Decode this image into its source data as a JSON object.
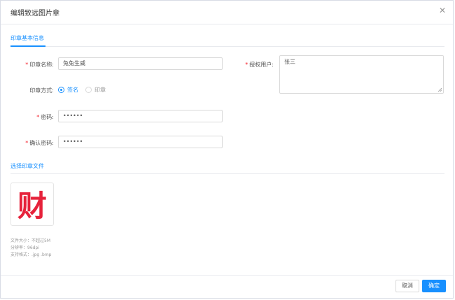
{
  "dialog": {
    "title": "编辑致远图片章",
    "close_icon": "close-icon"
  },
  "sections": {
    "basic_info_tab": "印章基本信息",
    "select_file_tab": "选择印章文件"
  },
  "form": {
    "seal_name": {
      "label": "印章名称:",
      "value": "兔兔生威",
      "required": true
    },
    "authorized_user": {
      "label": "授权用户:",
      "value": "张三",
      "required": true
    },
    "seal_method": {
      "label": "印章方式:",
      "options": [
        {
          "label": "签名",
          "checked": true
        },
        {
          "label": "印章",
          "checked": false
        }
      ]
    },
    "password": {
      "label": "密码:",
      "value": "••••••",
      "required": true
    },
    "confirm_password": {
      "label": "确认密码:",
      "value": "••••••",
      "required": true
    }
  },
  "seal_image": {
    "character": "财",
    "color": "#e6223b"
  },
  "hints": [
    "文件大小：不超过5M",
    "分辨率：96dpi",
    "支持格式：.jpg .bmp"
  ],
  "footer": {
    "cancel_label": "取消",
    "confirm_label": "确定"
  },
  "colors": {
    "accent": "#1890ff",
    "required": "#f5222d"
  }
}
